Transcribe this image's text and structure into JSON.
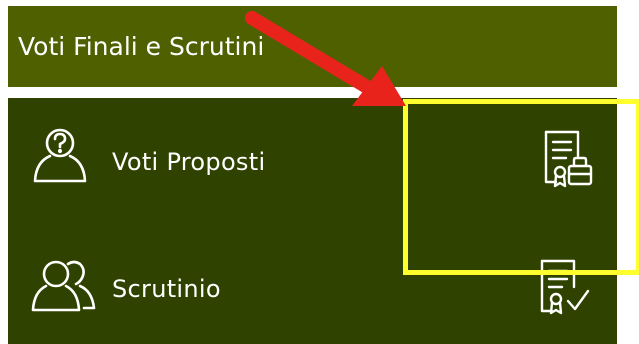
{
  "section": {
    "title": "Voti Finali e Scrutini"
  },
  "menu": {
    "items": [
      {
        "label": "Voti Proposti",
        "icon": "person-question-icon",
        "action_icon": "certificate-document-icon"
      },
      {
        "label": "Scrutinio",
        "icon": "group-icon",
        "action_icon": "certificate-check-icon"
      }
    ]
  },
  "colors": {
    "header_bg": "#4f6000",
    "panel_bg": "#2f4200",
    "text": "#ffffff",
    "highlight": "#ffff2e",
    "arrow": "#e8231c"
  }
}
